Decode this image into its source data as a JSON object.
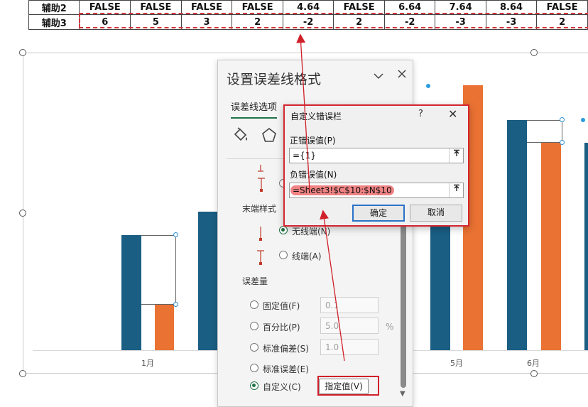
{
  "sheet": {
    "rows": [
      {
        "label": "辅助2",
        "cells": [
          "FALSE",
          "FALSE",
          "FALSE",
          "FALSE",
          "4.64",
          "FALSE",
          "6.64",
          "7.64",
          "8.64",
          "FALSE"
        ]
      },
      {
        "label": "辅助3",
        "cells": [
          "6",
          "5",
          "3",
          "2",
          "-2",
          "2",
          "-2",
          "-3",
          "-3",
          "2"
        ]
      }
    ]
  },
  "chart_data": {
    "type": "bar",
    "categories": [
      "1月",
      "5月",
      "6月"
    ],
    "series": [
      {
        "values": [
          null,
          null,
          null
        ],
        "color": "#1a5e83"
      },
      {
        "values": [
          null,
          null,
          null
        ],
        "color": "#ea7233"
      }
    ],
    "title": "",
    "xlabel": "",
    "ylabel": "",
    "grid": false,
    "legend": "none"
  },
  "pane": {
    "title": "设置误差线格式",
    "collapse_icon": "chevron-down-icon",
    "close_icon": "close-icon",
    "tab": "误差线选项",
    "icons": [
      "paint-bucket-icon",
      "pentagon-icon"
    ],
    "end_style_label": "末端样式",
    "no_cap": "无线端(N)",
    "cap": "线端(A)",
    "amount_label": "误差量",
    "options": [
      {
        "label": "固定值(F)",
        "value": "0.1",
        "selected": false
      },
      {
        "label": "百分比(P)",
        "value": "5.0",
        "unit": "%",
        "selected": false
      },
      {
        "label": "标准偏差(S)",
        "value": "1.0",
        "selected": false
      },
      {
        "label": "标准误差(E)",
        "selected": false
      },
      {
        "label": "自定义(C)",
        "selected": true
      }
    ],
    "specify_button": "指定值(V)"
  },
  "dialog": {
    "title": "自定义错误栏",
    "help": "?",
    "close": "✕",
    "positive_label": "正错误值(P)",
    "positive_value": "={1}",
    "negative_label": "负错误值(N)",
    "negative_value": "=Sheet3!$C$10:$N$10",
    "ok": "确定",
    "cancel": "取消",
    "collapse_icon": "collapse-range-icon"
  },
  "colors": {
    "bar_blue": "#1a5e83",
    "bar_orange": "#ea7233",
    "highlight_red": "#d0202a",
    "accent_green": "#217346"
  }
}
